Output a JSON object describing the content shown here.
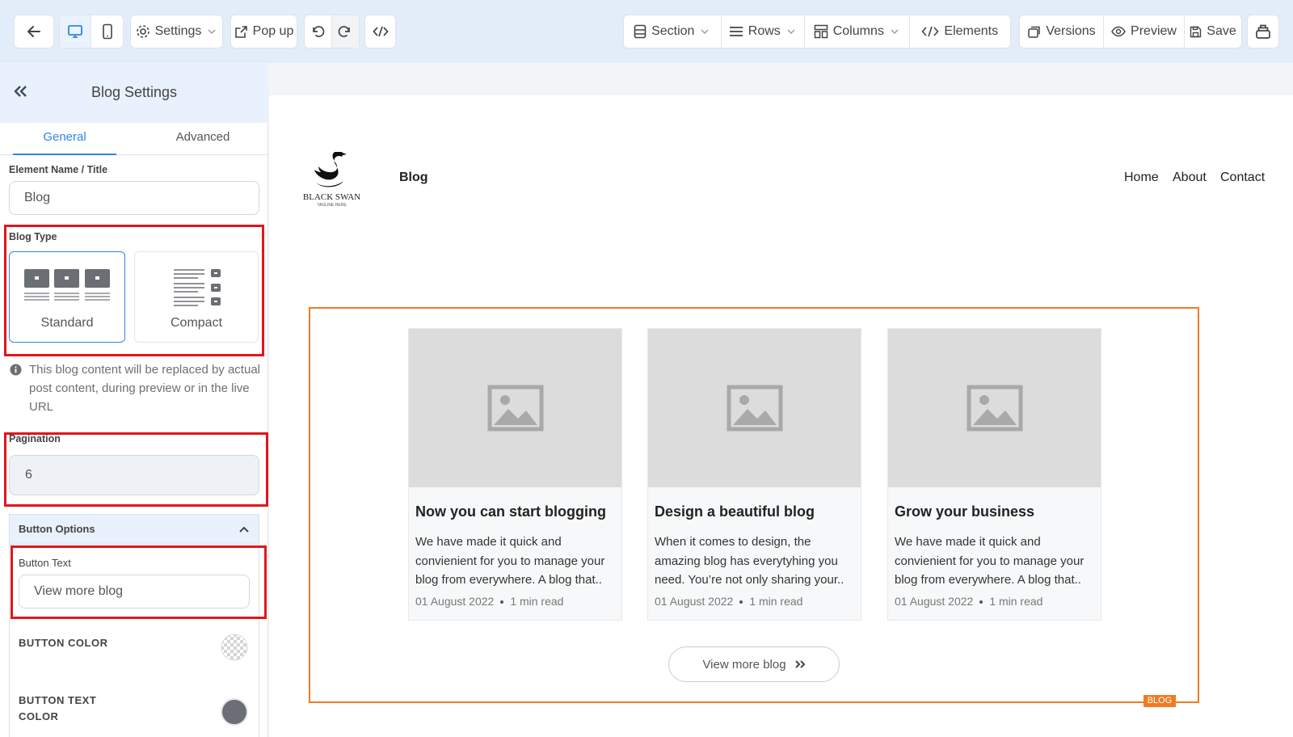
{
  "toolbar": {
    "settings_label": "Settings",
    "popup_label": "Pop up",
    "section_label": "Section",
    "rows_label": "Rows",
    "columns_label": "Columns",
    "elements_label": "Elements",
    "versions_label": "Versions",
    "preview_label": "Preview",
    "save_label": "Save"
  },
  "sidebar": {
    "title": "Blog Settings",
    "tabs": [
      {
        "label": "General",
        "active": true
      },
      {
        "label": "Advanced",
        "active": false
      }
    ],
    "element_name_label": "Element Name / Title",
    "element_name_value": "Blog",
    "blog_type_label": "Blog Type",
    "blog_types": [
      {
        "label": "Standard",
        "selected": true
      },
      {
        "label": "Compact",
        "selected": false
      }
    ],
    "info_text": "This blog content will be replaced by actual post content, during preview or in the live URL",
    "pagination_label": "Pagination",
    "pagination_value": "6",
    "button_options_label": "Button Options",
    "button_text_label": "Button Text",
    "button_text_value": "View more blog",
    "button_color_label": "BUTTON COLOR",
    "button_text_color_label": "BUTTON TEXT COLOR",
    "button_text_color": "#6b6e75"
  },
  "page": {
    "logo_name": "BLACK SWAN",
    "logo_tagline": "TAGLINE HERE",
    "site_title": "Blog",
    "nav": [
      "Home",
      "About",
      "Contact"
    ],
    "blog_badge": "BLOG",
    "posts": [
      {
        "title": "Now you can start blogging",
        "excerpt": "We have made it quick and convienient for you to manage your blog from everywhere. A blog that..",
        "date": "01 August 2022",
        "read": "1 min read"
      },
      {
        "title": "Design a beautiful blog",
        "excerpt": "When it comes to design, the amazing blog has everytyhing you need. You’re not only sharing your..",
        "date": "01 August 2022",
        "read": "1 min read"
      },
      {
        "title": "Grow your business",
        "excerpt": "We have made it quick and convienient for you to manage your blog from everywhere. A blog that..",
        "date": "01 August 2022",
        "read": "1 min read"
      }
    ],
    "more_button": "View more blog"
  },
  "colors": {
    "accent": "#2f86e6",
    "highlight": "#e0161c",
    "frame": "#f07b24"
  }
}
